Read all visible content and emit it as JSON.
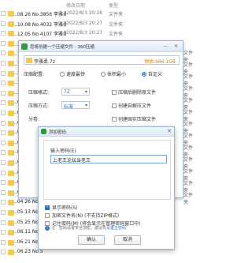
{
  "file_list": {
    "headers": {
      "date": "修改日期",
      "type": "类型"
    },
    "rows": [
      {
        "name": "..08.26 No.3856 李雅柔1...",
        "date": "2022/8/3 20:26",
        "type": "文件夹"
      },
      {
        "name": "..10.08 No.4032 李雅柔1...",
        "date": "2022/8/3 20:27",
        "type": "文件夹"
      },
      {
        "name": "..12.05 No.4107 李雅柔1...",
        "date": "2022/8/3 20:27",
        "type": "文件夹"
      },
      {
        "name": "..11.01 No.4184 李雅柔1...",
        "date": "2022/8/3 20:27",
        "type": "文件夹"
      },
      {
        "name": "..11.20 No.4179 李雅柔1...",
        "date": "2022/8/3 20:27",
        "type": "文件夹"
      },
      {
        "name": "..11.12 No.4208 李雅柔1...",
        "date": "2022/8/3 20:27",
        "type": "文件夹"
      },
      {
        "name": "..11.17 No.42",
        "date": "",
        "type": ""
      },
      {
        "name": "..11.20 No.42",
        "date": "",
        "type": ""
      },
      {
        "name": "..11.24 No.4",
        "date": "",
        "type": ""
      },
      {
        "name": "..01.24 No.45",
        "date": "",
        "type": ""
      },
      {
        "name": "..01.27 No.45",
        "date": "",
        "type": ""
      },
      {
        "name": "..02.06 No.4",
        "date": "",
        "type": ""
      },
      {
        "name": "..02.16 No.4",
        "date": "",
        "type": ""
      },
      {
        "name": "..03.20 No.4",
        "date": "",
        "type": ""
      },
      {
        "name": "..04.02 No.4",
        "date": "",
        "type": ""
      },
      {
        "name": "..04.12 No.4",
        "date": "",
        "type": ""
      },
      {
        "name": "..04.16 No.4",
        "date": "",
        "type": ""
      },
      {
        "name": "..04.18 No.4",
        "date": "",
        "type": ""
      },
      {
        "name": "..04.21 No.4",
        "date": "",
        "type": ""
      },
      {
        "name": "..04.26 No.4",
        "date": "",
        "type": ""
      },
      {
        "name": "..05.13 No.4",
        "date": "",
        "type": ""
      },
      {
        "name": "..05.25 No.5",
        "date": "",
        "type": ""
      },
      {
        "name": "..06.11 No.5",
        "date": "",
        "type": ""
      },
      {
        "name": "..06.21 No.5",
        "date": "",
        "type": ""
      },
      {
        "name": "..06.23 No.5",
        "date": "",
        "type": ""
      }
    ],
    "right_strip": [
      "文件夹",
      "文件夹",
      "文件夹",
      "文件夹",
      "文件夹",
      "文件夹",
      "文件夹",
      "文件夹",
      "文件夹",
      "文件夹",
      "文件夹",
      "文件夹",
      "文件夹"
    ]
  },
  "compress_dialog": {
    "title": "您将创建一个压缩文件 - 360压缩",
    "window_buttons": "— ✕",
    "filename": "李雅柔.7z",
    "size_label": "预估:966.1GB",
    "level_label": "压缩配置:",
    "level_options": [
      "速度最快",
      "体积最小",
      "自定义"
    ],
    "format_label": "压缩格式:",
    "format_value": "7Z",
    "method_label": "压缩方式:",
    "method_value": "标准",
    "split_label": "分卷:",
    "checkboxes": [
      "压缩后删除原文件",
      "创建自解压文件",
      "创建固实压缩文件"
    ],
    "colors": {
      "accent": "#2a72c8",
      "size": "#e07b00"
    }
  },
  "password_dialog": {
    "title": "添加密码",
    "close": "✕",
    "input_label": "输入密码(E)",
    "password_value": "上老王论坛当老王",
    "options": [
      {
        "label": "显示密码(S)",
        "checked": true
      },
      {
        "label": "加密文件名(N) (不支持ZIP格式)",
        "checked": false
      },
      {
        "label": "记住密码(M) (将会显示在管理密码窗口中)",
        "checked": false
      }
    ],
    "hint_text": "注：密码设置安全加密，建议先",
    "hint_link": "设置主密码",
    "ok_label": "确认",
    "cancel_label": "取消"
  }
}
